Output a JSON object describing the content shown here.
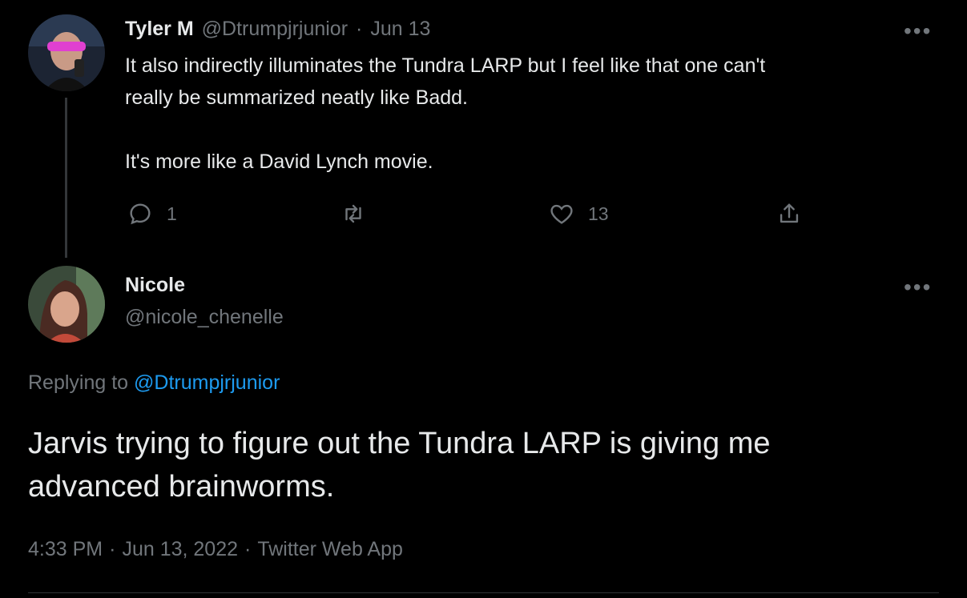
{
  "reply_parent": {
    "author_name": "Tyler M",
    "author_handle": "@Dtrumpjrjunior",
    "separator": "·",
    "date": "Jun 13",
    "text": "It also indirectly illuminates the Tundra LARP but I feel like that one  can't\nreally be summarized neatly like Badd.\n\nIt's more like a David Lynch movie.",
    "actions": {
      "reply_count": "1",
      "retweet_count": "",
      "like_count": "13"
    },
    "more_icon": "more-horizontal-icon"
  },
  "main_tweet": {
    "author_name": "Nicole",
    "author_handle": "@nicole_chenelle",
    "replying_prefix": "Replying to",
    "replying_to": "@Dtrumpjrjunior",
    "text": "Jarvis trying to figure out the Tundra LARP is giving me\nadvanced brainworms.",
    "time": "4:33 PM",
    "sep1": "·",
    "date": "Jun 13, 2022",
    "sep2": "·",
    "source": "Twitter Web App"
  },
  "colors": {
    "background": "#000000",
    "text": "#e7e9ea",
    "muted": "#71767b",
    "link": "#1d9bf0"
  }
}
